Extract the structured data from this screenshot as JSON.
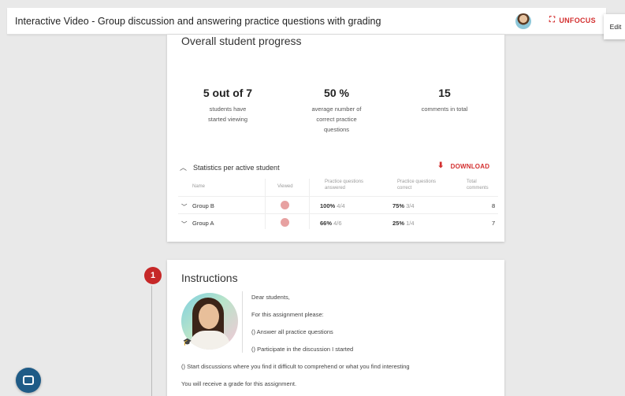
{
  "header": {
    "title": "Interactive Video - Group discussion and answering practice questions with grading",
    "unfocus_label": "UNFOCUS",
    "edit_label": "Edit"
  },
  "progress": {
    "title": "Overall student progress",
    "stats": [
      {
        "value": "5 out of 7",
        "desc": "students have started viewing"
      },
      {
        "value": "50 %",
        "desc": "average number of correct practice questions"
      },
      {
        "value": "15",
        "desc": "comments in total"
      }
    ],
    "stats_section_label": "Statistics per active student",
    "download_label": "DOWNLOAD",
    "columns": {
      "name": "Name",
      "viewed": "Viewed",
      "answered": "Practice questions answered",
      "correct": "Practice questions correct",
      "comments": "Total comments"
    },
    "rows": [
      {
        "name": "Group B",
        "answered_pct": "100%",
        "answered_frac": "4/4",
        "correct_pct": "75%",
        "correct_frac": "3/4",
        "comments": "8"
      },
      {
        "name": "Group A",
        "answered_pct": "66%",
        "answered_frac": "4/6",
        "correct_pct": "25%",
        "correct_frac": "1/4",
        "comments": "7"
      }
    ]
  },
  "instructions": {
    "step_number": "1",
    "title": "Instructions",
    "lines": [
      "Dear students,",
      "For this assignment please:",
      "() Answer all practice questions",
      "() Participate in the discussion I started",
      "() Start discussions where you find it difficult to comprehend or what you find interesting",
      "You will receive a grade for this assignment."
    ]
  },
  "icons": {
    "unfocus": "unfocus-icon",
    "download": "download-icon",
    "chat": "chat-icon"
  },
  "colors": {
    "accent_red": "#d32f2f",
    "viewed_dot": "#e7a1a1",
    "chat_button": "#1f5b86"
  }
}
